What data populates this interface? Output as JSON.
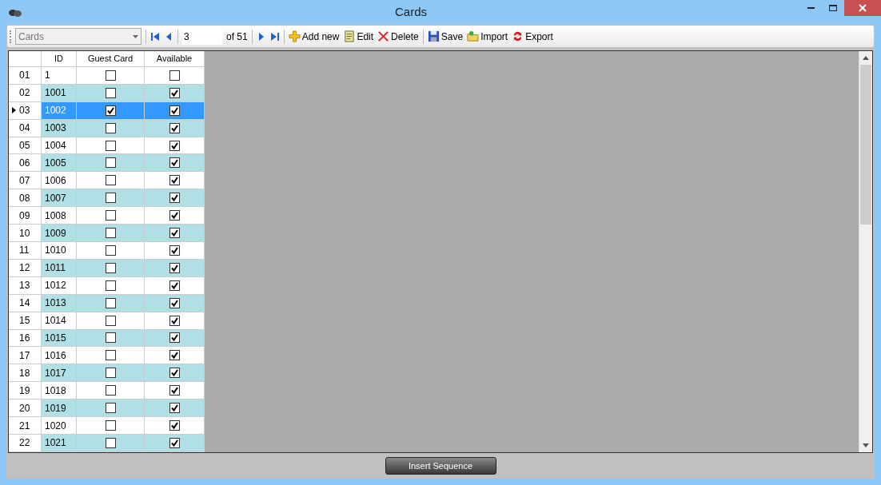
{
  "window": {
    "title": "Cards"
  },
  "toolbar": {
    "combo": {
      "value": "Cards"
    },
    "position": {
      "value": "3",
      "count": "of 51"
    },
    "actions": [
      "Add new",
      "Edit",
      "Delete",
      "Save",
      "Import",
      "Export"
    ]
  },
  "table": {
    "columns": [
      "ID",
      "Guest Card",
      "Available"
    ],
    "rows": [
      {
        "number": "01",
        "id": "1",
        "guest_card": false,
        "available": false,
        "selected": false
      },
      {
        "number": "02",
        "id": "1001",
        "guest_card": false,
        "available": true,
        "selected": false
      },
      {
        "number": "03",
        "id": "1002",
        "guest_card": true,
        "available": true,
        "selected": true
      },
      {
        "number": "04",
        "id": "1003",
        "guest_card": false,
        "available": true,
        "selected": false
      },
      {
        "number": "05",
        "id": "1004",
        "guest_card": false,
        "available": true,
        "selected": false
      },
      {
        "number": "06",
        "id": "1005",
        "guest_card": false,
        "available": true,
        "selected": false
      },
      {
        "number": "07",
        "id": "1006",
        "guest_card": false,
        "available": true,
        "selected": false
      },
      {
        "number": "08",
        "id": "1007",
        "guest_card": false,
        "available": true,
        "selected": false
      },
      {
        "number": "09",
        "id": "1008",
        "guest_card": false,
        "available": true,
        "selected": false
      },
      {
        "number": "10",
        "id": "1009",
        "guest_card": false,
        "available": true,
        "selected": false
      },
      {
        "number": "11",
        "id": "1010",
        "guest_card": false,
        "available": true,
        "selected": false
      },
      {
        "number": "12",
        "id": "1011",
        "guest_card": false,
        "available": true,
        "selected": false
      },
      {
        "number": "13",
        "id": "1012",
        "guest_card": false,
        "available": true,
        "selected": false
      },
      {
        "number": "14",
        "id": "1013",
        "guest_card": false,
        "available": true,
        "selected": false
      },
      {
        "number": "15",
        "id": "1014",
        "guest_card": false,
        "available": true,
        "selected": false
      },
      {
        "number": "16",
        "id": "1015",
        "guest_card": false,
        "available": true,
        "selected": false
      },
      {
        "number": "17",
        "id": "1016",
        "guest_card": false,
        "available": true,
        "selected": false
      },
      {
        "number": "18",
        "id": "1017",
        "guest_card": false,
        "available": true,
        "selected": false
      },
      {
        "number": "19",
        "id": "1018",
        "guest_card": false,
        "available": true,
        "selected": false
      },
      {
        "number": "20",
        "id": "1019",
        "guest_card": false,
        "available": true,
        "selected": false
      },
      {
        "number": "21",
        "id": "1020",
        "guest_card": false,
        "available": true,
        "selected": false
      },
      {
        "number": "22",
        "id": "1021",
        "guest_card": false,
        "available": true,
        "selected": false
      }
    ]
  },
  "footer": {
    "button": "Insert Sequence"
  }
}
